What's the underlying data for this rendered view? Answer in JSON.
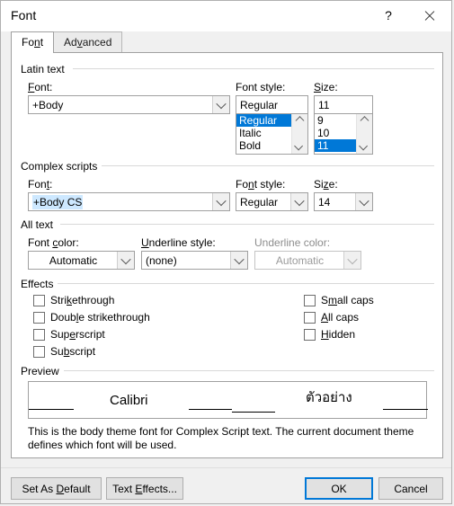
{
  "window": {
    "title": "Font",
    "help_label": "?",
    "close_label": "✕"
  },
  "tabs": [
    {
      "label": "Font",
      "accel": "n",
      "active": true
    },
    {
      "label": "Advanced",
      "accel": "v",
      "active": false
    }
  ],
  "groups": {
    "latin": {
      "title": "Latin text",
      "font_label": "Font:",
      "font_value": "+Body",
      "style_label": "Font style:",
      "style_value": "Regular",
      "style_options": [
        "Regular",
        "Italic",
        "Bold"
      ],
      "style_selected": "Regular",
      "size_label": "Size:",
      "size_value": "11",
      "size_options": [
        "9",
        "10",
        "11"
      ],
      "size_selected": "11"
    },
    "complex": {
      "title": "Complex scripts",
      "font_label": "Font:",
      "font_value": "+Body CS",
      "style_label": "Font style:",
      "style_value": "Regular",
      "size_label": "Size:",
      "size_value": "14"
    },
    "alltext": {
      "title": "All text",
      "font_color_label": "Font color:",
      "font_color_value": "Automatic",
      "underline_style_label": "Underline style:",
      "underline_style_value": "(none)",
      "underline_color_label": "Underline color:",
      "underline_color_value": "Automatic"
    },
    "effects": {
      "title": "Effects",
      "items": [
        {
          "label": "Strikethrough",
          "checked": false
        },
        {
          "label": "Double strikethrough",
          "checked": false
        },
        {
          "label": "Superscript",
          "checked": false
        },
        {
          "label": "Subscript",
          "checked": false
        },
        {
          "label": "Small caps",
          "checked": false
        },
        {
          "label": "All caps",
          "checked": false
        },
        {
          "label": "Hidden",
          "checked": false
        }
      ]
    },
    "preview": {
      "title": "Preview",
      "latin_sample": "Calibri",
      "complex_sample": "ตัวอย่าง",
      "description": "This is the body theme font for Complex Script text. The current document theme defines which font will be used."
    }
  },
  "buttons": {
    "set_as_default": "Set As Default",
    "text_effects": "Text Effects...",
    "ok": "OK",
    "cancel": "Cancel"
  },
  "colors": {
    "selection_blue": "#0078d7",
    "field_highlight": "#cde8ff",
    "dialog_bg": "#f0f0f0",
    "panel_bg": "#ffffff",
    "disabled_text": "#8d8d8d"
  }
}
